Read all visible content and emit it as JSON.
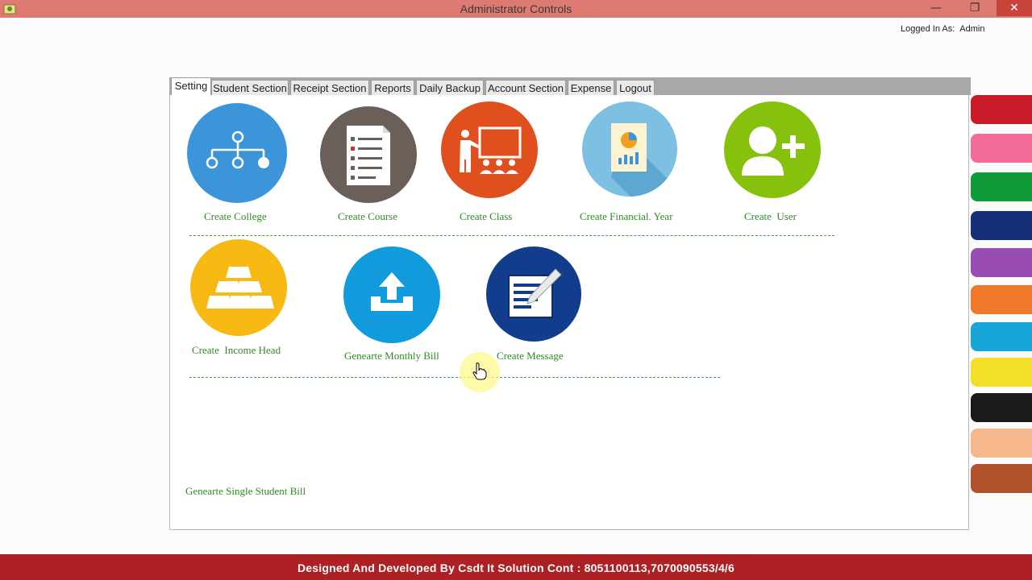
{
  "window": {
    "title": "Administrator Controls",
    "logged_in_label": "Logged In As:",
    "logged_in_user": "Admin"
  },
  "tabs": [
    {
      "label": "Setting",
      "active": true
    },
    {
      "label": "Student Section"
    },
    {
      "label": "Receipt Section"
    },
    {
      "label": "Reports"
    },
    {
      "label": "Daily Backup"
    },
    {
      "label": "Account Section"
    },
    {
      "label": "Expense"
    },
    {
      "label": "Logout"
    }
  ],
  "tiles": {
    "create_college": {
      "label": "Create College",
      "color": "#3b95d8",
      "icon": "hierarchy-icon"
    },
    "create_course": {
      "label": "Create Course",
      "color": "#6b5f5a",
      "icon": "document-list-icon"
    },
    "create_class": {
      "label": "Create Class",
      "color": "#e0501f",
      "icon": "classroom-icon"
    },
    "create_financial_year": {
      "label": "Create Financial. Year",
      "color": "#7ec0e2",
      "icon": "report-chart-icon"
    },
    "create_user": {
      "label": "Create  User",
      "color": "#86c10e",
      "icon": "add-user-icon"
    },
    "create_income_head": {
      "label": "Create  Income Head",
      "color": "#f7b914",
      "icon": "gold-bars-icon"
    },
    "generate_monthly_bill": {
      "label": "Genearte Monthly Bill",
      "color": "#119bdc",
      "icon": "upload-tray-icon"
    },
    "create_message": {
      "label": "Create Message",
      "color": "#123d8c",
      "icon": "edit-note-icon"
    }
  },
  "links": {
    "single_student_bill": "Genearte Single Student Bill"
  },
  "footer": {
    "credit": "Designed And Developed By Csdt It Solution Cont :  8051100113,7070090553/4/6"
  },
  "colors": {
    "titlebar": "#dd7a72",
    "footer": "#ad2024",
    "link_green": "#2e8b22"
  }
}
